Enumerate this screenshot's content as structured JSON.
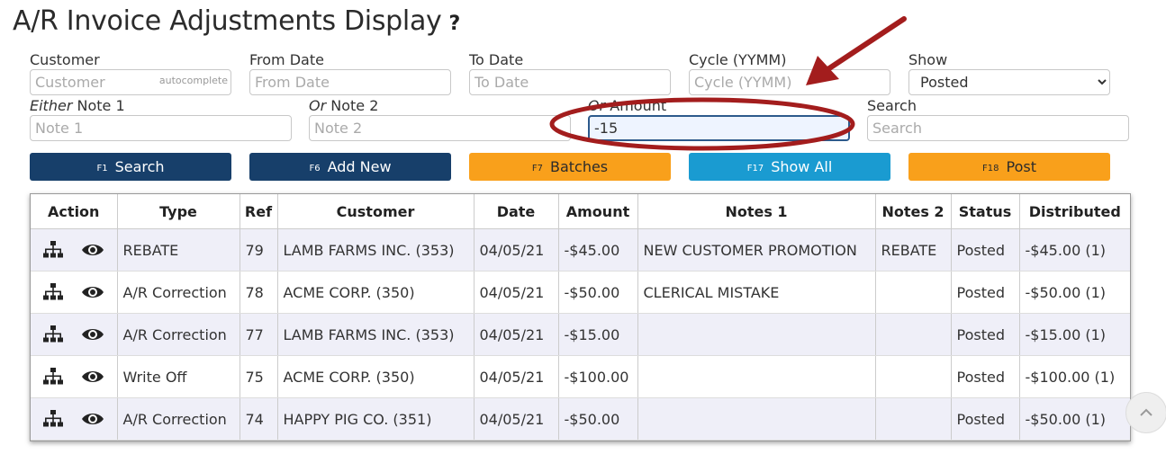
{
  "title": "A/R Invoice Adjustments Display",
  "help": "?",
  "filters": {
    "customer": {
      "label": "Customer",
      "placeholder": "Customer",
      "hint": "autocomplete",
      "value": ""
    },
    "from_date": {
      "label": "From Date",
      "placeholder": "From Date",
      "value": ""
    },
    "to_date": {
      "label": "To Date",
      "placeholder": "To Date",
      "value": ""
    },
    "cycle": {
      "label": "Cycle (YYMM)",
      "placeholder": "Cycle (YYMM)",
      "value": ""
    },
    "show": {
      "label": "Show",
      "selected": "Posted"
    },
    "note1": {
      "label_em": "Either",
      "label": " Note 1",
      "placeholder": "Note 1",
      "value": ""
    },
    "note2": {
      "label_em": "Or",
      "label": " Note 2",
      "placeholder": "Note 2",
      "value": ""
    },
    "amount": {
      "label_em": "Or",
      "label": " Amount",
      "placeholder": "",
      "value": "-15"
    },
    "search": {
      "label": "Search",
      "placeholder": "Search",
      "value": ""
    }
  },
  "buttons": {
    "search": {
      "key": "F1",
      "label": "Search"
    },
    "add_new": {
      "key": "F6",
      "label": "Add New"
    },
    "batches": {
      "key": "F7",
      "label": "Batches"
    },
    "show_all": {
      "key": "F17",
      "label": "Show All"
    },
    "post": {
      "key": "F18",
      "label": "Post"
    }
  },
  "table": {
    "headers": [
      "Action",
      "Type",
      "Ref",
      "Customer",
      "Date",
      "Amount",
      "Notes 1",
      "Notes 2",
      "Status",
      "Distributed"
    ],
    "rows": [
      {
        "type": "REBATE",
        "ref": "79",
        "customer": "LAMB FARMS INC. (353)",
        "date": "04/05/21",
        "amount": "-$45.00",
        "notes1": "NEW CUSTOMER PROMOTION",
        "notes2": "REBATE",
        "status": "Posted",
        "distributed": "-$45.00 (1)"
      },
      {
        "type": "A/R Correction",
        "ref": "78",
        "customer": "ACME CORP. (350)",
        "date": "04/05/21",
        "amount": "-$50.00",
        "notes1": "CLERICAL MISTAKE",
        "notes2": "",
        "status": "Posted",
        "distributed": "-$50.00 (1)"
      },
      {
        "type": "A/R Correction",
        "ref": "77",
        "customer": "LAMB FARMS INC. (353)",
        "date": "04/05/21",
        "amount": "-$15.00",
        "notes1": "",
        "notes2": "",
        "status": "Posted",
        "distributed": "-$15.00 (1)"
      },
      {
        "type": "Write Off",
        "ref": "75",
        "customer": "ACME CORP. (350)",
        "date": "04/05/21",
        "amount": "-$100.00",
        "notes1": "",
        "notes2": "",
        "status": "Posted",
        "distributed": "-$100.00 (1)"
      },
      {
        "type": "A/R Correction",
        "ref": "74",
        "customer": "HAPPY PIG CO. (351)",
        "date": "04/05/21",
        "amount": "-$50.00",
        "notes1": "",
        "notes2": "",
        "status": "Posted",
        "distributed": "-$50.00 (1)"
      }
    ]
  },
  "icons": {
    "hierarchy": "sitemap-icon",
    "view": "eye-icon",
    "scroll": "chevron-up-icon"
  },
  "colors": {
    "dark_button": "#173f6a",
    "orange_button": "#f9a01b",
    "blue_button": "#1a9bd1",
    "annotation": "#a31d1d",
    "alt_row": "#efeff8"
  }
}
